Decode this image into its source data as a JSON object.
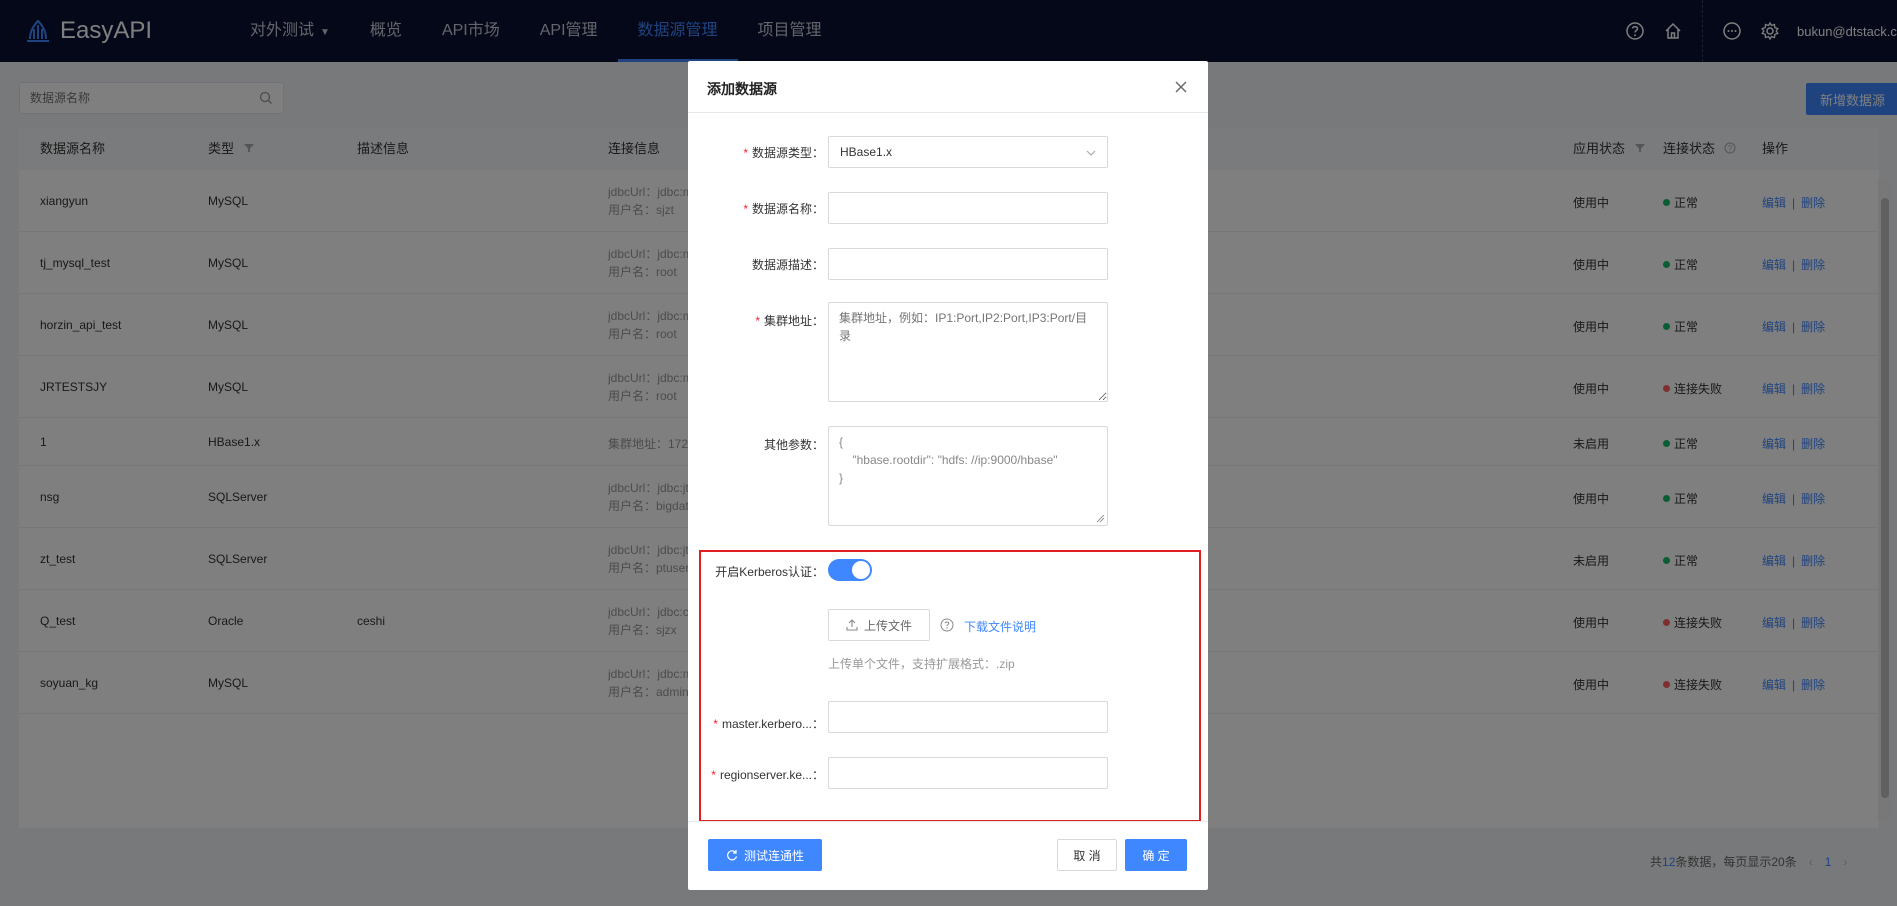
{
  "app": {
    "name": "EasyAPI"
  },
  "nav": {
    "items": [
      {
        "label": "对外测试",
        "has_caret": true
      },
      {
        "label": "概览"
      },
      {
        "label": "API市场"
      },
      {
        "label": "API管理"
      },
      {
        "label": "数据源管理",
        "active": true
      },
      {
        "label": "项目管理"
      }
    ],
    "user": "bukun@dtstack.c..."
  },
  "search": {
    "placeholder": "数据源名称"
  },
  "toolbar": {
    "add_label": "新增数据源"
  },
  "table": {
    "headers": {
      "name": "数据源名称",
      "type": "类型",
      "desc": "描述信息",
      "conn": "连接信息",
      "app_status": "应用状态",
      "conn_status": "连接状态",
      "ops": "操作"
    },
    "rows": [
      {
        "name": "xiangyun",
        "type": "MySQL",
        "desc": "",
        "conn1": "jdbcUrl：jdbc:m",
        "conn2": "用户名：sjzt",
        "app_status": "使用中",
        "conn_status": "正常",
        "ok": true
      },
      {
        "name": "tj_mysql_test",
        "type": "MySQL",
        "desc": "",
        "conn1": "jdbcUrl：jdbc:m",
        "conn2": "用户名：root",
        "app_status": "使用中",
        "conn_status": "正常",
        "ok": true
      },
      {
        "name": "horzin_api_test",
        "type": "MySQL",
        "desc": "",
        "conn1": "jdbcUrl：jdbc:m",
        "conn2": "用户名：root",
        "app_status": "使用中",
        "conn_status": "正常",
        "ok": true
      },
      {
        "name": "JRTESTSJY",
        "type": "MySQL",
        "desc": "",
        "conn1": "jdbcUrl：jdbc:m",
        "conn2": "用户名：root",
        "app_status": "使用中",
        "conn_status": "连接失败",
        "ok": false
      },
      {
        "name": "1",
        "type": "HBase1.x",
        "desc": "",
        "conn1": "集群地址：172",
        "conn2": "",
        "app_status": "未启用",
        "conn_status": "正常",
        "ok": true
      },
      {
        "name": "nsg",
        "type": "SQLServer",
        "desc": "",
        "conn1": "jdbcUrl：jdbc:jt",
        "conn2": "用户名：bigdat",
        "app_status": "使用中",
        "conn_status": "正常",
        "ok": true
      },
      {
        "name": "zt_test",
        "type": "SQLServer",
        "desc": "",
        "conn1": "jdbcUrl：jdbc:jt",
        "conn2": "用户名：ptuser",
        "app_status": "未启用",
        "conn_status": "正常",
        "ok": true
      },
      {
        "name": "Q_test",
        "type": "Oracle",
        "desc": "ceshi",
        "conn1": "jdbcUrl：jdbc:c",
        "conn2": "用户名：sjzx",
        "app_status": "使用中",
        "conn_status": "连接失败",
        "ok": false
      },
      {
        "name": "soyuan_kg",
        "type": "MySQL",
        "desc": "",
        "conn1": "jdbcUrl：jdbc:m",
        "conn2": "用户名：admin",
        "app_status": "使用中",
        "conn_status": "连接失败",
        "ok": false
      }
    ],
    "op_edit": "编辑",
    "op_sep": "|",
    "op_delete": "删除"
  },
  "pagination": {
    "prefix": "共",
    "total": "12",
    "suffix": "条数据，每页显示20条",
    "current": "1"
  },
  "modal": {
    "title": "添加数据源",
    "fields": {
      "type_label": "数据源类型：",
      "type_value": "HBase1.x",
      "name_label": "数据源名称：",
      "name_value": "",
      "desc_label": "数据源描述：",
      "desc_value": "",
      "cluster_label": "集群地址：",
      "cluster_placeholder": "集群地址，例如：IP1:Port,IP2:Port,IP3:Port/目录",
      "other_label": "其他参数：",
      "other_line1": "{",
      "other_line2": "    \"hbase.rootdir\": \"hdfs: //ip:9000/hbase\"",
      "other_line3": "}",
      "kerberos_label": "开启Kerberos认证：",
      "upload_label": "上传文件",
      "download_label": "下载文件说明",
      "upload_hint": "上传单个文件，支持扩展格式：.zip",
      "master_label": "master.kerbero...：",
      "region_label": "regionserver.ke...："
    },
    "footer": {
      "test_label": "测试连通性",
      "cancel_label": "取 消",
      "ok_label": "确 定"
    }
  },
  "colors": {
    "accent": "#3f87ff",
    "nav_bg": "#0a1033",
    "ok": "#12bc6a",
    "fail": "#ff5f5c",
    "highlight": "#e02020"
  }
}
